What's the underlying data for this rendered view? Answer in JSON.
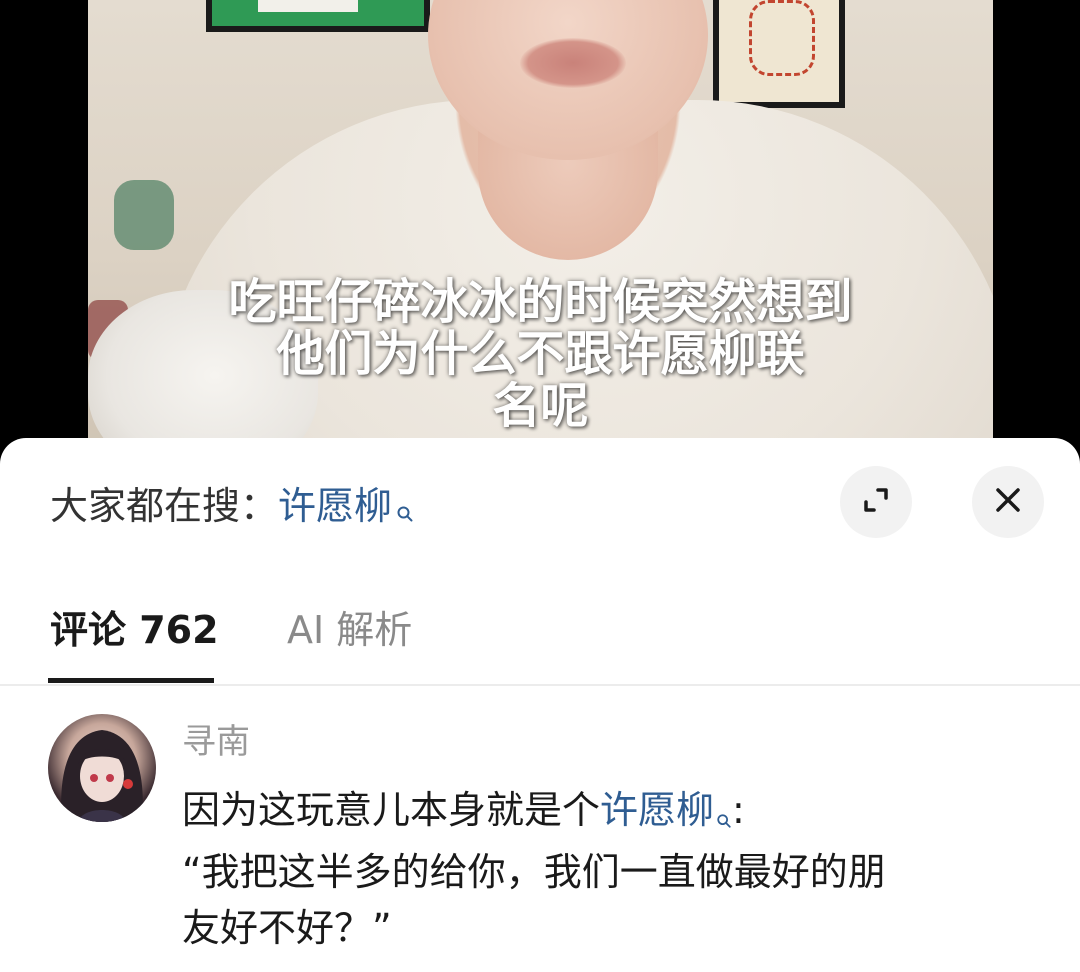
{
  "video": {
    "subtitle_line1": "吃旺仔碎冰冰的时候突然想到",
    "subtitle_line2": "他们为什么不跟许愿柳联",
    "subtitle_line3": "名呢"
  },
  "search": {
    "prefix": "大家都在搜：",
    "term": "许愿柳",
    "icon": "search-icon"
  },
  "buttons": {
    "expand_icon": "expand-icon",
    "close_icon": "close-icon"
  },
  "tabs": [
    {
      "label": "评论 762",
      "active": true
    },
    {
      "label": "AI 解析",
      "active": false
    }
  ],
  "comment": {
    "author": "寻南",
    "text_before_link": "因为这玩意儿本身就是个",
    "link_text": "许愿柳",
    "text_after_link": ":",
    "line2": "“我把这半多的给你，我们一直做最好的朋",
    "line3": "友好不好？”"
  },
  "colors": {
    "link": "#2f5d92",
    "tab_active": "#1a1a1a",
    "tab_inactive": "#8a8a8a",
    "author": "#9a9a9a"
  }
}
